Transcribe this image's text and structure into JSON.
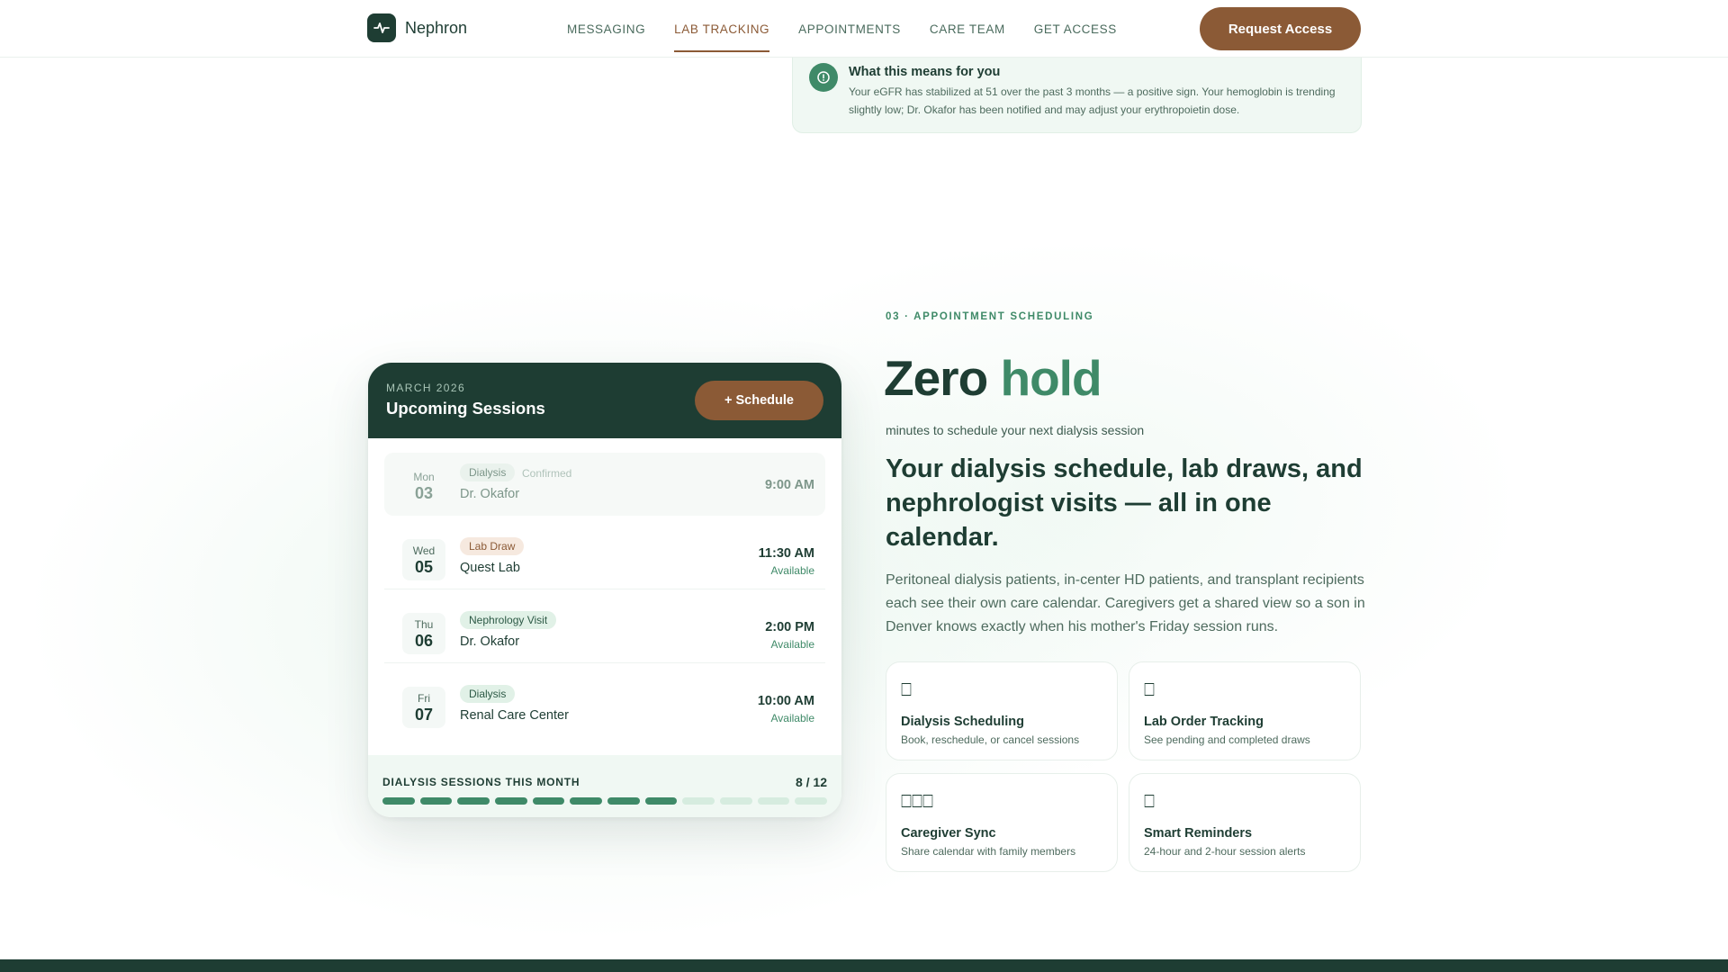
{
  "nav": {
    "brand": "Nephron",
    "links": [
      {
        "label": "MESSAGING",
        "active": false
      },
      {
        "label": "LAB TRACKING",
        "active": true
      },
      {
        "label": "APPOINTMENTS",
        "active": false
      },
      {
        "label": "CARE TEAM",
        "active": false
      },
      {
        "label": "GET ACCESS",
        "active": false
      }
    ],
    "cta": "Request Access"
  },
  "note": {
    "title": "What this means for you",
    "text": "Your eGFR has stabilized at 51 over the past 3 months — a positive sign. Your hemoglobin is trending slightly low; Dr. Okafor has been notified and may adjust your erythropoietin dose."
  },
  "calendar": {
    "month": "MARCH 2026",
    "title": "Upcoming Sessions",
    "schedule_button": "+ Schedule",
    "sessions": [
      {
        "dow": "Mon",
        "day": "03",
        "tag": "Dialysis",
        "tag_style": "green",
        "status": "Confirmed",
        "who": "Dr. Okafor",
        "time": "9:00 AM",
        "availability": ""
      },
      {
        "dow": "Wed",
        "day": "05",
        "tag": "Lab Draw",
        "tag_style": "brown",
        "status": "",
        "who": "Quest Lab",
        "time": "11:30 AM",
        "availability": "Available"
      },
      {
        "dow": "Thu",
        "day": "06",
        "tag": "Nephrology Visit",
        "tag_style": "green",
        "status": "",
        "who": "Dr. Okafor",
        "time": "2:00 PM",
        "availability": "Available"
      },
      {
        "dow": "Fri",
        "day": "07",
        "tag": "Dialysis",
        "tag_style": "green",
        "status": "",
        "who": "Renal Care Center",
        "time": "10:00 AM",
        "availability": "Available"
      }
    ],
    "footer_label": "DIALYSIS SESSIONS THIS MONTH",
    "footer_count": "8 / 12",
    "completed": 8,
    "total": 12
  },
  "section": {
    "eyebrow": "03 · APPOINTMENT SCHEDULING",
    "hero_main": "Zero",
    "hero_accent": "hold",
    "hero_sub": "minutes to schedule your next dialysis session",
    "heading": "Your dialysis schedule, lab draws, and nephrologist visits — all in one calendar.",
    "paragraph": "Peritoneal dialysis patients, in-center HD patients, and transplant recipients each see their own care calendar. Caregivers get a shared view so a son in Denver knows exactly when his mother's Friday session runs.",
    "features": [
      {
        "icon": "calendar-icon",
        "glyph": "⎕",
        "title": "Dialysis Scheduling",
        "desc": "Book, reschedule, or cancel sessions"
      },
      {
        "icon": "clipboard-icon",
        "glyph": "⎕",
        "title": "Lab Order Tracking",
        "desc": "See pending and completed draws"
      },
      {
        "icon": "family-icon",
        "glyph": "⎕⎕⎕",
        "title": "Caregiver Sync",
        "desc": "Share calendar with family members"
      },
      {
        "icon": "bell-icon",
        "glyph": "⎕",
        "title": "Smart Reminders",
        "desc": "24-hour and 2-hour session alerts"
      }
    ]
  },
  "colors": {
    "brand_dark": "#1e3d33",
    "accent_green": "#3f8a68",
    "accent_brown": "#8b5a36",
    "progress_done": "#3f8a68",
    "progress_todo": "#d6ecdf"
  }
}
